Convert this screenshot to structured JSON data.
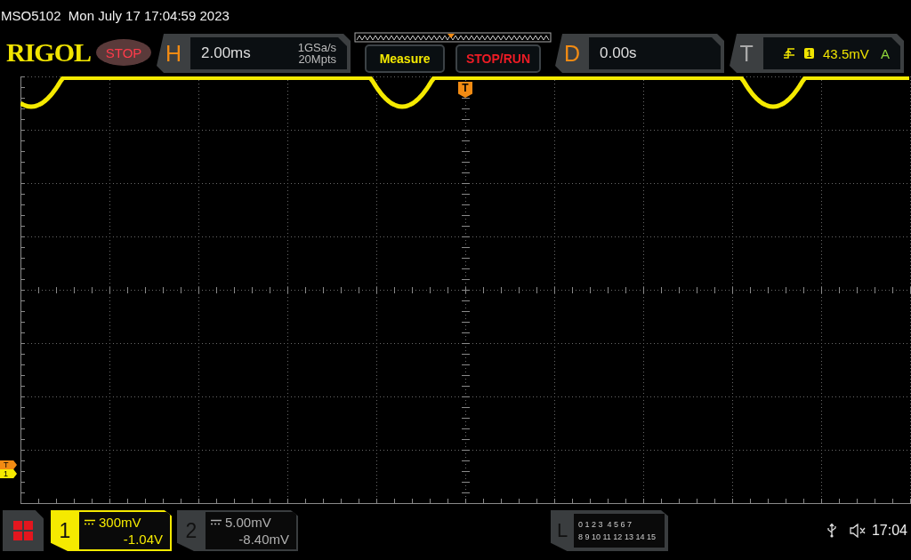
{
  "status_line": "MSO5102  Mon July 17 17:04:59 2023",
  "toolbar": {
    "logo": "RIGOL",
    "run_state": {
      "label": "STOP",
      "kind": "stop"
    },
    "horizontal": {
      "letter": "H",
      "timebase": "2.00ms",
      "sample_rate": "1GSa/s",
      "memory_depth": "20Mpts"
    },
    "buttons": [
      {
        "label": "Measure",
        "kind": "measure"
      },
      {
        "label": "STOP/RUN",
        "kind": "run"
      }
    ],
    "delay": {
      "letter": "D",
      "value": "0.00s"
    },
    "trigger": {
      "letter": "T",
      "source": "1",
      "level": "43.5mV",
      "mode": "A"
    }
  },
  "display": {
    "trigger_marker": "T",
    "left_markers": [
      {
        "label": "T",
        "kind": "trigger"
      },
      {
        "label": "1",
        "kind": "channel"
      }
    ]
  },
  "channels": [
    {
      "number": "1",
      "scale": "300mV",
      "offset": "-1.04V",
      "selected": true
    },
    {
      "number": "2",
      "scale": "5.00mV",
      "offset": "-8.40mV",
      "selected": false
    }
  ],
  "logic": {
    "letter": "L",
    "rows": [
      "0 1 2 3  4 5 6 7",
      "8 9 10 11 12 13 14 15"
    ]
  },
  "status_bar": {
    "time": "17:04"
  }
}
